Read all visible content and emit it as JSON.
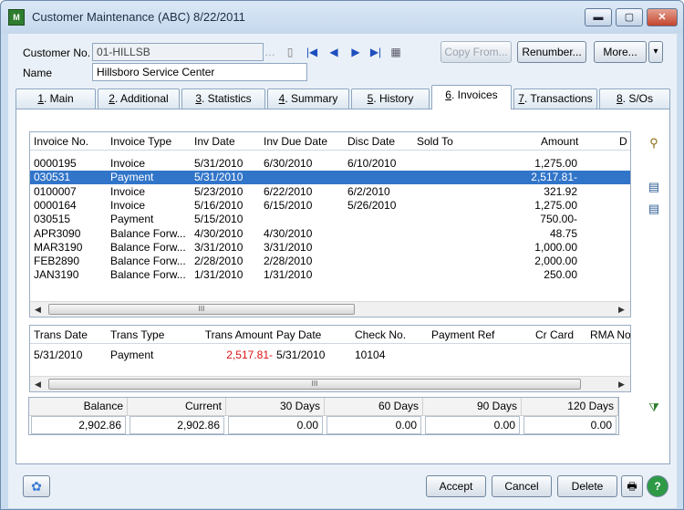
{
  "window": {
    "title": "Customer Maintenance (ABC) 8/22/2011",
    "app_icon_text": "M",
    "minimize": "▬",
    "maximize": "▢",
    "close": "✕"
  },
  "customer": {
    "customer_no_label": "Customer No.",
    "customer_no": "01-HILLSB",
    "name_label": "Name",
    "name": "Hillsboro Service Center"
  },
  "toolbar": {
    "copy_from": "Copy From...",
    "renumber": "Renumber...",
    "more": "More...",
    "more_arrow": "▾"
  },
  "nav": {
    "first": "|◀",
    "prev": "◀",
    "next": "▶",
    "last": "▶|",
    "calendar": "▦",
    "lookup": "…",
    "doc": "▯"
  },
  "tabs": [
    {
      "num": "1",
      "label": ". Main"
    },
    {
      "num": "2",
      "label": ". Additional"
    },
    {
      "num": "3",
      "label": ". Statistics"
    },
    {
      "num": "4",
      "label": ". Summary"
    },
    {
      "num": "5",
      "label": ". History"
    },
    {
      "num": "6",
      "label": ". Invoices"
    },
    {
      "num": "7",
      "label": ". Transactions"
    },
    {
      "num": "8",
      "label": ". S/Os"
    }
  ],
  "invoices": {
    "headers": [
      "Invoice No.",
      "Invoice Type",
      "Inv Date",
      "Inv Due Date",
      "Disc Date",
      "Sold To",
      "Amount",
      "D"
    ],
    "rows": [
      [
        "0000195",
        "Invoice",
        "5/31/2010",
        "6/30/2010",
        "6/10/2010",
        "",
        "1,275.00"
      ],
      [
        "030531",
        "Payment",
        "5/31/2010",
        "",
        "",
        "",
        "2,517.81-"
      ],
      [
        "0100007",
        "Invoice",
        "5/23/2010",
        "6/22/2010",
        "6/2/2010",
        "",
        "321.92"
      ],
      [
        "0000164",
        "Invoice",
        "5/16/2010",
        "6/15/2010",
        "5/26/2010",
        "",
        "1,275.00"
      ],
      [
        "030515",
        "Payment",
        "5/15/2010",
        "",
        "",
        "",
        "750.00-"
      ],
      [
        "APR3090",
        "Balance Forw...",
        "4/30/2010",
        "4/30/2010",
        "",
        "",
        "48.75"
      ],
      [
        "MAR3190",
        "Balance Forw...",
        "3/31/2010",
        "3/31/2010",
        "",
        "",
        "1,000.00"
      ],
      [
        "FEB2890",
        "Balance Forw...",
        "2/28/2010",
        "2/28/2010",
        "",
        "",
        "2,000.00"
      ],
      [
        "JAN3190",
        "Balance Forw...",
        "1/31/2010",
        "1/31/2010",
        "",
        "",
        "250.00"
      ]
    ],
    "selected_row": 1,
    "scroll_thumb": "III"
  },
  "transactions": {
    "headers": [
      "Trans Date",
      "Trans Type",
      "Trans Amount",
      "Pay Date",
      "Check No.",
      "Payment Ref",
      "Cr Card",
      "RMA No"
    ],
    "rows": [
      [
        "5/31/2010",
        "Payment",
        "2,517.81-",
        "5/31/2010",
        "10104",
        "",
        "",
        ""
      ]
    ],
    "scroll_thumb": "III"
  },
  "aging": {
    "headers": [
      "Balance",
      "Current",
      "30 Days",
      "60 Days",
      "90 Days",
      "120 Days"
    ],
    "values": [
      "2,902.86",
      "2,902.86",
      "0.00",
      "0.00",
      "0.00",
      "0.00"
    ]
  },
  "buttons": {
    "accept": "Accept",
    "cancel": "Cancel",
    "delete": "Delete",
    "print": "🖶",
    "help": "?"
  },
  "side_tools": {
    "binoculars": "⚲",
    "doc1": "▤",
    "doc2": "▤",
    "filter": "⧩"
  },
  "colors": {
    "selection": "#3175c9",
    "negative_amount": "#dd1111"
  }
}
